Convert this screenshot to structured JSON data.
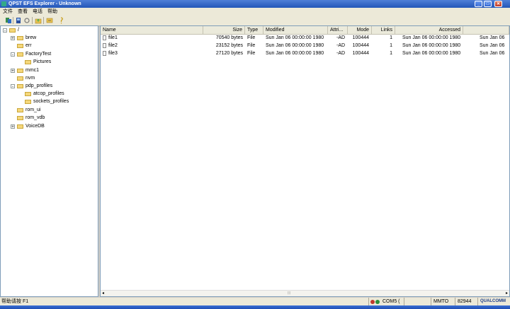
{
  "window": {
    "title": "QPST EFS Explorer - Unknown",
    "minimize": "_",
    "maximize": "□",
    "close": "✕"
  },
  "menu": {
    "file": "文件",
    "view": "查看",
    "phone": "电话",
    "help": "帮助"
  },
  "toolbar": {
    "icons": [
      "copy-icon",
      "phone-icon",
      "refresh-icon",
      "up-folder-icon",
      "properties-icon",
      "help-icon"
    ]
  },
  "tree": {
    "root": {
      "label": "/",
      "expander": "-"
    },
    "nodes": [
      {
        "label": "brew",
        "expander": "+"
      },
      {
        "label": "err",
        "expander": ""
      },
      {
        "label": "FactoryTest",
        "expander": "-"
      },
      {
        "label": "Pictures",
        "expander": ""
      },
      {
        "label": "mmc1",
        "expander": "+"
      },
      {
        "label": "nvm",
        "expander": ""
      },
      {
        "label": "pdp_profiles",
        "expander": "-"
      },
      {
        "label": "atcop_profiles",
        "expander": ""
      },
      {
        "label": "sockets_profiles",
        "expander": ""
      },
      {
        "label": "rom_ui",
        "expander": ""
      },
      {
        "label": "rom_vdb",
        "expander": ""
      },
      {
        "label": "VoiceDB",
        "expander": "+"
      }
    ]
  },
  "list": {
    "columns": [
      "Name",
      "Size",
      "Type",
      "Modified",
      "Attri...",
      "Mode",
      "Links",
      "Accessed",
      ""
    ],
    "rows": [
      {
        "name": "file1",
        "size": "70540 bytes",
        "type": "File",
        "modified": "Sun Jan 06 00:00:00 1980",
        "attr": "-AD",
        "mode": "100444",
        "links": "1",
        "accessed": "Sun Jan 06 00:00:00 1980",
        "extra": "Sun Jan 06"
      },
      {
        "name": "file2",
        "size": "23152 bytes",
        "type": "File",
        "modified": "Sun Jan 06 00:00:00 1980",
        "attr": "-AD",
        "mode": "100444",
        "links": "1",
        "accessed": "Sun Jan 06 00:00:00 1980",
        "extra": "Sun Jan 06"
      },
      {
        "name": "file3",
        "size": "27120 bytes",
        "type": "File",
        "modified": "Sun Jan 06 00:00:00 1980",
        "attr": "-AD",
        "mode": "100444",
        "links": "1",
        "accessed": "Sun Jan 06 00:00:00 1980",
        "extra": "Sun Jan 06"
      }
    ],
    "scroll_grip": "⦙⦙⦙"
  },
  "status": {
    "help_text": "帮助请按 F1",
    "port": "COM5 (",
    "mode": "MMTO",
    "esn": "82944",
    "brand": "QUALCOMM"
  }
}
